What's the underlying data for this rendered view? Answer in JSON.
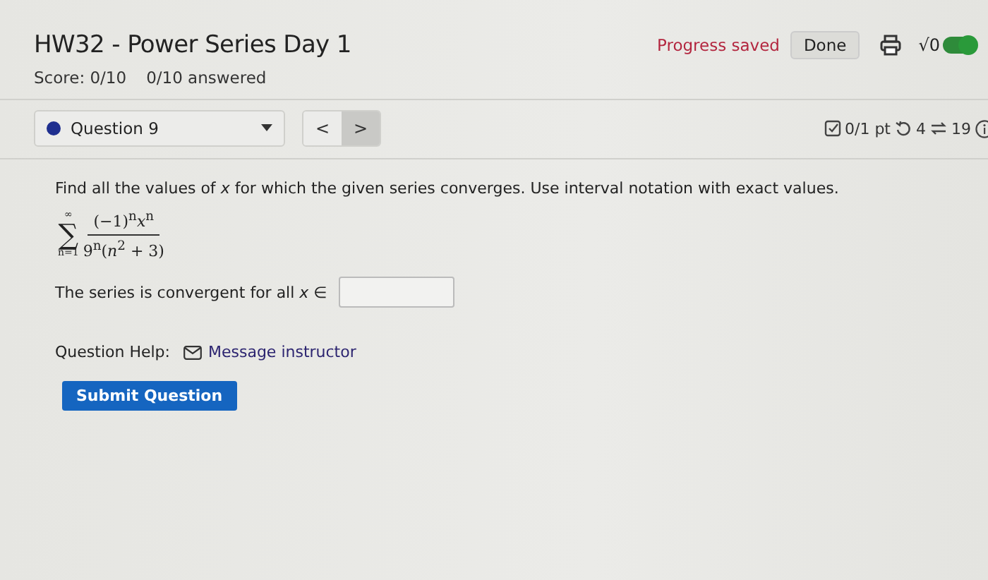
{
  "header": {
    "title": "HW32 - Power Series Day 1",
    "score": "Score: 0/10",
    "answered": "0/10 answered",
    "progress": "Progress saved",
    "done_button": "Done",
    "math_toggle": {
      "label": "√0",
      "on": true
    }
  },
  "question_nav": {
    "question": "Question 9",
    "prev": "<",
    "next": ">"
  },
  "question_info": {
    "points": "0/1 pt",
    "retries": "4",
    "attempts": "19"
  },
  "question": {
    "prompt": "Find all the values of *x* for which the given series converges. Use interval notation with exact values.",
    "formula": {
      "sum": "∑",
      "upper": "∞",
      "lower": "n=1",
      "numerator": "(−1)$^{n}$*x*$^{n}$",
      "denominator": "9$^{n}$(*n*$^{2}$ + 3)"
    },
    "answer_label": "The series is convergent for all *x* ∈",
    "help_label": "Question Help:",
    "help_link": "Message instructor",
    "submit": "Submit Question"
  }
}
